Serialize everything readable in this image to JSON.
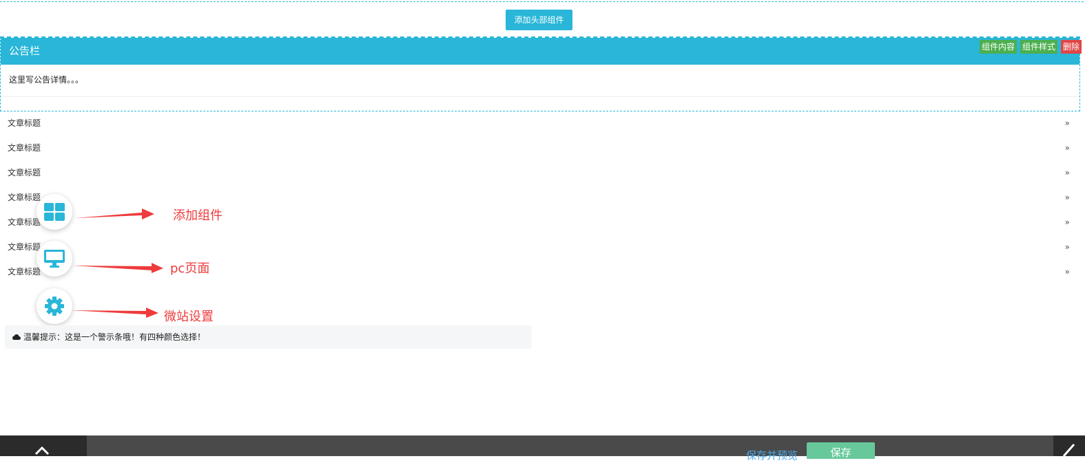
{
  "header_zone": {
    "add_header_label": "添加头部组件"
  },
  "notice": {
    "title": "公告栏",
    "content": "这里写公告详情。。。",
    "tools": {
      "content_label": "组件内容",
      "style_label": "组件样式",
      "delete_label": "删除"
    }
  },
  "articles": [
    {
      "title": "文章标题",
      "arrow": "»"
    },
    {
      "title": "文章标题",
      "arrow": "»"
    },
    {
      "title": "文章标题",
      "arrow": "»"
    },
    {
      "title": "文章标题",
      "arrow": "»"
    },
    {
      "title": "文章标题",
      "arrow": "»"
    },
    {
      "title": "文章标题",
      "arrow": "»"
    },
    {
      "title": "文章标题",
      "arrow": "»"
    }
  ],
  "floating_actions": {
    "add_component": {
      "icon": "grid-icon",
      "annotation": "添加组件"
    },
    "pc_page": {
      "icon": "monitor-icon",
      "annotation": "pc页面"
    },
    "site_settings": {
      "icon": "gear-icon",
      "annotation": "微站设置"
    }
  },
  "alert": {
    "icon": "cloud-icon",
    "text": "温馨提示：这是一个警示条哦！有四种颜色选择！"
  },
  "bottom_bar": {
    "save_preview_label": "保存并预览",
    "save_label": "保存",
    "up_icon": "chevron-up-icon",
    "edit_icon": "pencil-icon"
  },
  "colors": {
    "accent": "#29b6d8",
    "annotation": "#ee3b3b",
    "tool_green": "#4caf50",
    "tool_red": "#e04646",
    "save_green": "#67c99b",
    "bar": "#4a4a4a"
  }
}
